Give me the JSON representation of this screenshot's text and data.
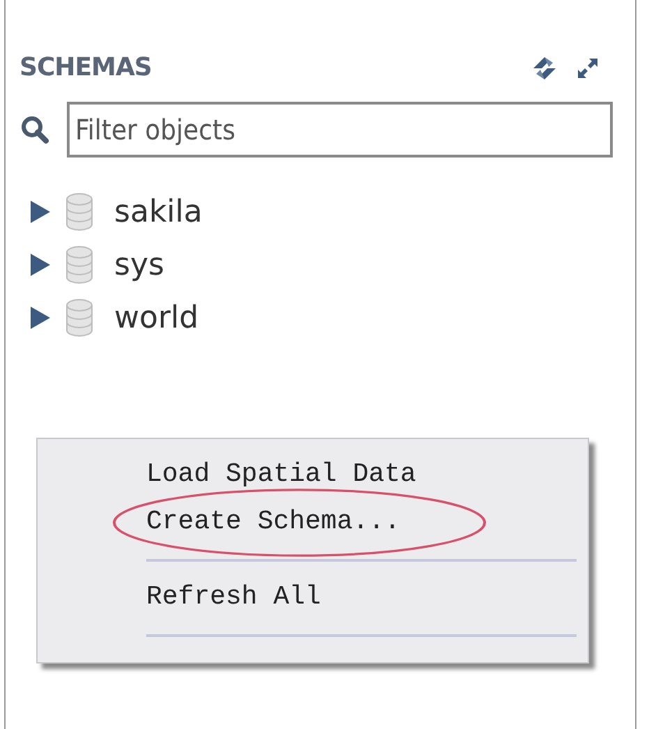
{
  "panel": {
    "title": "SCHEMAS"
  },
  "filter": {
    "placeholder": "Filter objects"
  },
  "schemas": [
    {
      "name": "sakila",
      "expanded": false
    },
    {
      "name": "sys",
      "expanded": false
    },
    {
      "name": "world",
      "expanded": false
    }
  ],
  "context_menu": {
    "items": [
      {
        "kind": "item",
        "label": "Load Spatial Data",
        "circled": false
      },
      {
        "kind": "item",
        "label": "Create Schema...",
        "circled": true
      },
      {
        "kind": "separator"
      },
      {
        "kind": "item",
        "label": "Refresh All",
        "circled": false
      },
      {
        "kind": "separator"
      }
    ]
  }
}
